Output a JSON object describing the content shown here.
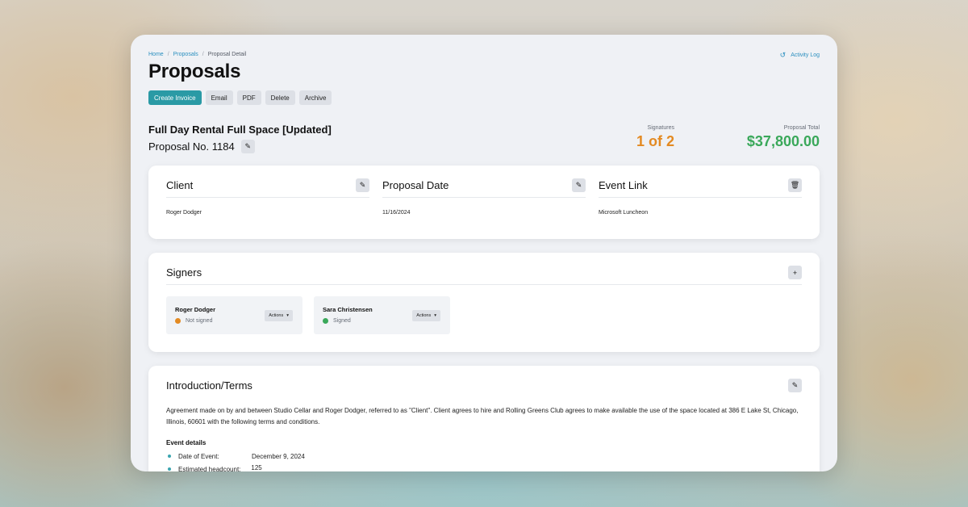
{
  "breadcrumb": {
    "home": "Home",
    "proposals": "Proposals",
    "current": "Proposal Detail",
    "sep": "/"
  },
  "activity": {
    "icon": "history-icon",
    "label": "Activity Log"
  },
  "page": {
    "title": "Proposals"
  },
  "toolbar": {
    "create_invoice": "Create Invoice",
    "email": "Email",
    "pdf": "PDF",
    "delete": "Delete",
    "archive": "Archive"
  },
  "proposal": {
    "name": "Full Day Rental Full Space [Updated]",
    "number_label": "Proposal No. 1184"
  },
  "stats": {
    "signatures_label": "Signatures",
    "signatures_value": "1 of 2",
    "total_label": "Proposal Total",
    "total_value": "$37,800.00"
  },
  "info": {
    "client": {
      "title": "Client",
      "value": "Roger Dodger"
    },
    "date": {
      "title": "Proposal Date",
      "value": "11/16/2024"
    },
    "event": {
      "title": "Event Link",
      "value": "Microsoft Luncheon"
    }
  },
  "signers": {
    "title": "Signers",
    "items": [
      {
        "name": "Roger Dodger",
        "status": "Not signed",
        "status_color": "#e38a22",
        "action": "Actions"
      },
      {
        "name": "Sara Christensen",
        "status": "Signed",
        "status_color": "#3aa85a",
        "action": "Actions"
      }
    ]
  },
  "intro": {
    "title": "Introduction/Terms",
    "text": "Agreement made on by and between Studio Cellar and Roger Dodger, referred to as \"Client\". Client agrees to hire and Rolling Greens Club agrees to make available the use of the space located at 386 E Lake St, Chicago, Illinois, 60601 with the following terms and conditions.",
    "event_heading": "Event details",
    "details": [
      {
        "key": "Date of Event:",
        "value": "December 9, 2024"
      },
      {
        "key": "Estimated headcount:",
        "value": "125"
      }
    ]
  },
  "colors": {
    "accent": "#2a9aa5",
    "link": "#2a8fbf",
    "warning": "#e38a22",
    "success": "#3aa85a"
  }
}
